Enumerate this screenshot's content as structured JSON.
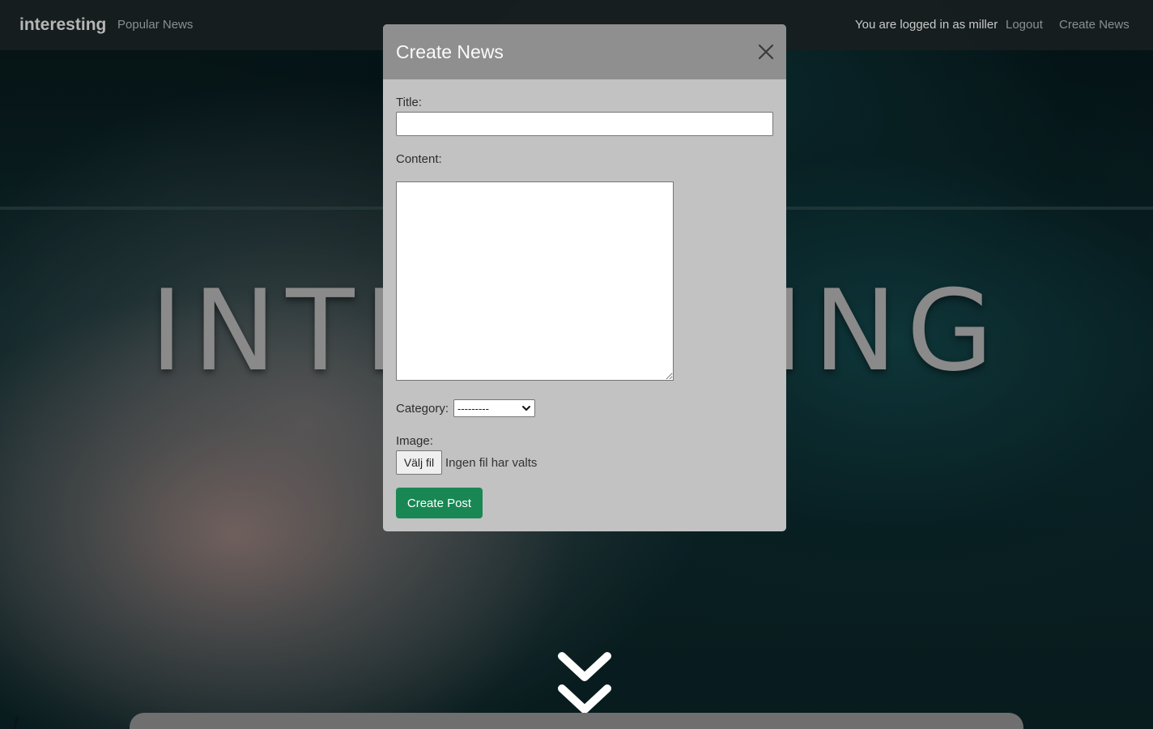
{
  "navbar": {
    "brand": "interesting",
    "popular_link": "Popular News",
    "user_text": "You are logged in as miller",
    "logout_link": "Logout",
    "create_link": "Create News"
  },
  "hero": {
    "title": "INTERESTING"
  },
  "modal": {
    "title": "Create News",
    "title_label": "Title:",
    "title_value": "",
    "content_label": "Content:",
    "content_value": "",
    "category_label": "Category:",
    "category_selected": "---------",
    "image_label": "Image:",
    "file_button": "Välj fil",
    "file_status": "Ingen fil har valts",
    "submit": "Create Post"
  },
  "colors": {
    "submit_green": "#198754",
    "modal_header": "#8f8f8f",
    "modal_body": "#c2c2c2"
  }
}
